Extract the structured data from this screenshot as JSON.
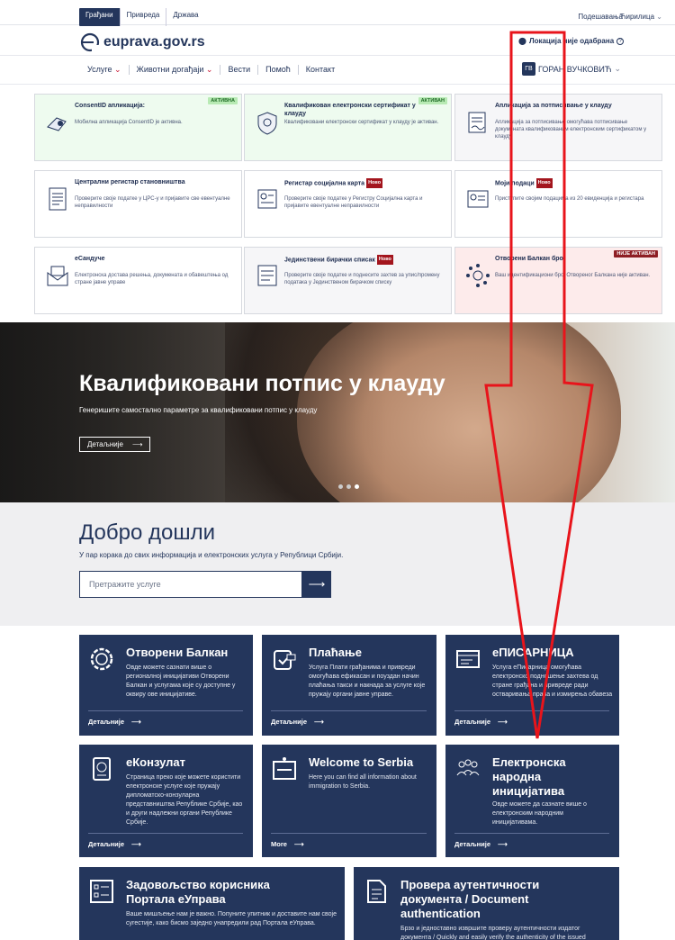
{
  "topbar": {
    "tabs": [
      "Грађани",
      "Привреда",
      "Држава"
    ],
    "settings": "Подешавања",
    "language": "Ћирилица"
  },
  "header": {
    "logo_text": "euprava.gov.rs",
    "location": "Локација није одабрана"
  },
  "nav": {
    "items": [
      "Услуге",
      "Животни догађаји",
      "Вести",
      "Помоћ",
      "Контакт"
    ],
    "user_name": "ГОРАН ВУЧКОВИЋ",
    "user_initials": "ГВ"
  },
  "cards": [
    {
      "title": "ConsentID апликација:",
      "desc": "Мобилна апликација ConsentID је активна.",
      "badge": "АКТИВНА",
      "icon": "consent-icon"
    },
    {
      "title": "Квалификован електронски сертификат у клауду",
      "desc": "Квалификовани електронски сертификат у клауду је активан.",
      "badge": "АКТИВАН",
      "icon": "certificate-icon"
    },
    {
      "title": "Апликација за потписивање у клауду",
      "desc": "Апликација за потписивање омогућава потписивање докумената квалификованим електронским сертификатом у клауду.",
      "badge": "",
      "icon": "signing-icon"
    },
    {
      "title": "Централни регистар становништва",
      "desc": "Проверите своје податке у ЦРС-у и пријавите све евентуалне неправилности",
      "new": "",
      "icon": "registry-icon"
    },
    {
      "title": "Регистар социјална карта",
      "desc": "Проверите своје податке у Регистру Социјална карта и пријавите евентуалне неправилности",
      "new": "Ново",
      "icon": "social-card-icon"
    },
    {
      "title": "Моји подаци",
      "desc": "Приступите својим подацима из 20 евиденција и регистара",
      "new": "Ново",
      "icon": "my-data-icon"
    },
    {
      "title": "еСандуче",
      "desc": "Електронска достава решења, докумената и обавештења од стране јавне управе",
      "new": "",
      "icon": "mailbox-icon"
    },
    {
      "title": "Јединствени бирачки списак",
      "desc": "Проверите своје податке и поднесите захтев за упис/промену података у Јединственом бирачком списку",
      "new": "Ново",
      "icon": "voter-list-icon"
    },
    {
      "title": "Отворени Балкан број",
      "desc": "Ваш идентификациони број Отвореног Балкана није активан.",
      "badge": "НИЈЕ АКТИВАН",
      "icon": "network-icon"
    }
  ],
  "hero": {
    "title": "Квалификовани потпис у клауду",
    "subtitle": "Генеришите самостално параметре за квалификовани потпис у клауду",
    "button": "Детаљније"
  },
  "welcome": {
    "title": "Добро дошли",
    "text": "У пар корака до свих информација и електронских услуга у Републици Србији.",
    "search_placeholder": "Претражите услуге"
  },
  "tiles": [
    {
      "title": "Отворени Балкан",
      "desc": "Овде можете сазнати више о регионалној иницијативи Отворени Балкан и услугама које су доступне у оквиру ове иницијативе.",
      "more": "Детаљније",
      "icon": "open-balkan-icon"
    },
    {
      "title": "Плаћање",
      "desc": "Услуга Плати грађанима и привреди омогућава ефикасан и поуздан начин плаћања такси и накнада за услуге које пружају органи јавне управе.",
      "more": "Детаљније",
      "icon": "payment-icon"
    },
    {
      "title": "еПИСАРНИЦА",
      "desc": "Услуга еПисарница омогућава електронско подношење захтева од стране грађана и привреде ради остваривања права и измирења обавеза",
      "more": "Детаљније",
      "icon": "registry-office-icon"
    },
    {
      "title": "еКонзулат",
      "desc": "Страница преко које можете користити електронске услуге које пружају дипломатско-конзуларна представништва Републике Србије, као и други надлежни органи Републике Србије.",
      "more": "Детаљније",
      "icon": "passport-icon"
    },
    {
      "title": "Welcome to Serbia",
      "desc": "Here you can find all information about immigration to Serbia.",
      "more": "More",
      "icon": "welcome-icon"
    },
    {
      "title": "Електронска народна иницијатива",
      "desc": "Овде можете да сазнате више о електронским народним иницијативама.",
      "more": "Детаљније",
      "icon": "people-icon"
    },
    {
      "title": "Задовољство корисника Портала еУправа",
      "desc": "Ваше мишљење нам је важно. Попуните упитник и доставите нам своје сугестије, како бисмо заједно унапредили рад Портала еУправа.",
      "icon": "checklist-icon"
    },
    {
      "title": "Провера аутентичности документа / Document authentication",
      "desc": "Брзо и једноставно извршите проверу аутентичности издатог документа / Quickly and easily verify the authenticity of the issued",
      "icon": "document-icon"
    }
  ],
  "colors": {
    "primary": "#24365c",
    "annotation": "#e8141b"
  }
}
